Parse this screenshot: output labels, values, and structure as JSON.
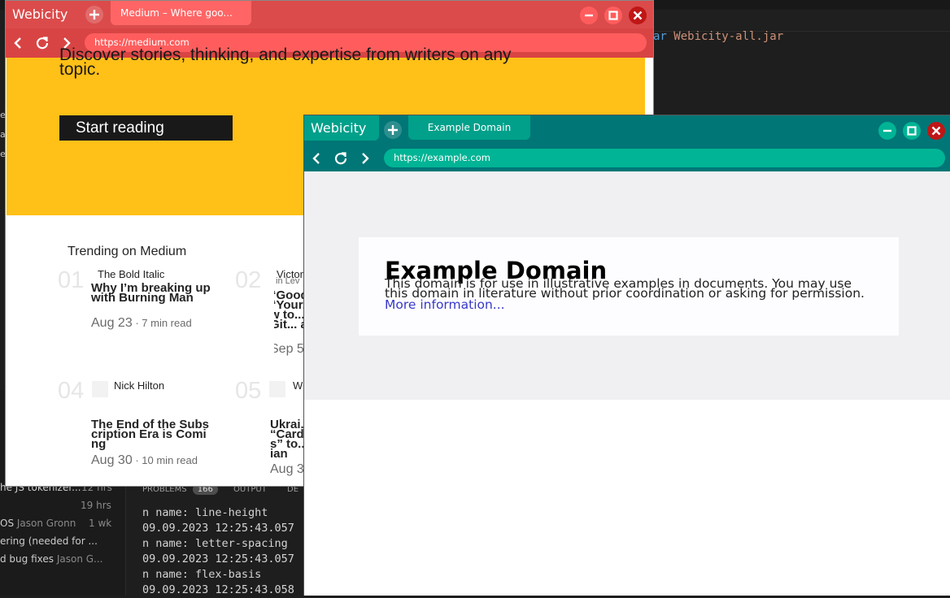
{
  "ide": {
    "code_keyword": "ar",
    "code_text": " Webicity-all.jar",
    "side_letters": [
      "e",
      "a",
      "e"
    ],
    "git_rows": [
      {
        "text": "he JS tokenizer...",
        "time": "12 hrs"
      },
      {
        "text": "",
        "time": "19 hrs"
      },
      {
        "text": "OS",
        "author": "Jason Gronn",
        "time": "1 wk"
      },
      {
        "text": "ering (needed for ...",
        "author": "",
        "time": ""
      },
      {
        "text": "d bug fixes",
        "author": "Jason G...",
        "time": ""
      }
    ],
    "panel_tabs": {
      "problems": "PROBLEMS",
      "problems_count": "166",
      "output": "OUTPUT",
      "debug": "DE"
    },
    "terminal_lines": [
      "n name: line-height",
      "09.09.2023 12:25:43.057",
      "n name: letter-spacing",
      "09.09.2023 12:25:43.057",
      "n name: flex-basis",
      "09.09.2023 12:25:43.058"
    ]
  },
  "medium_window": {
    "brand": "Webicity",
    "tab_label": "Medium – Where goo...",
    "url": "https://medium.com",
    "hero_text": "Discover stories, thinking, and expertise from writers on any topic.",
    "start_button": "Start reading",
    "trending_heading": "Trending on Medium",
    "articles": [
      {
        "num": "01",
        "author": "The Bold Italic",
        "title": "Why I’m breaking up with Burning Man",
        "date": "Aug 23",
        "read": "7 min read"
      },
      {
        "num": "02",
        "author": "Victor",
        "author_sub": "in Lev",
        "title": "“Good... “Your... ow to... ct Git... age",
        "date": "Sep 5",
        "read": ""
      },
      {
        "num": "04",
        "author": "Nick Hilton",
        "title": "The End of the Subscription Era is Coming",
        "date": "Aug 30",
        "read": "10 min read"
      },
      {
        "num": "05",
        "author": "W",
        "title": "Ukrai... “Card... s” to... ssian",
        "date": "Aug 3",
        "read": ""
      }
    ]
  },
  "example_window": {
    "brand": "Webicity",
    "tab_label": "Example Domain",
    "url": "https://example.com",
    "heading": "Example Domain",
    "paragraph": "This domain is for use in illustrative examples in documents. You may use this domain in literature without prior coordination or asking for permission.",
    "link": "More information..."
  },
  "colors": {
    "medium_titlebar": "#db4b4b",
    "medium_url": "#ff5d5d",
    "medium_hero": "#ffc017",
    "example_titlebar": "#007676",
    "example_url": "#00b495",
    "example_tab": "#00a08a"
  }
}
